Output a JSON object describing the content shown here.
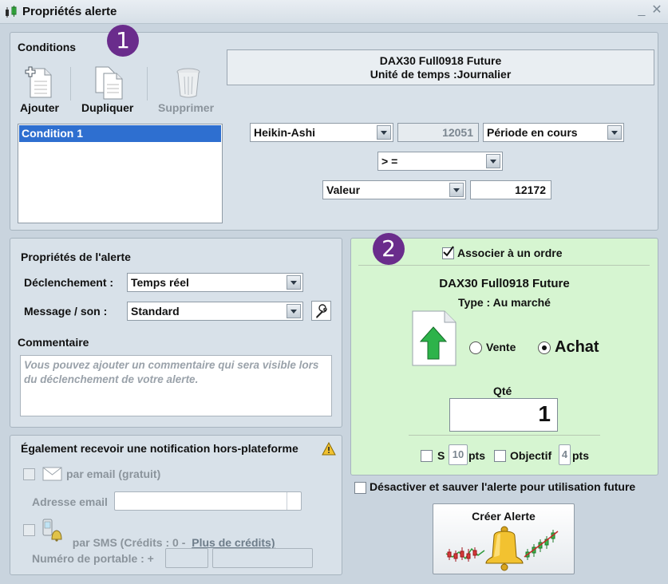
{
  "window": {
    "title": "Propriétés alerte"
  },
  "conditions": {
    "heading": "Conditions",
    "toolbar": {
      "add_label": "Ajouter",
      "duplicate_label": "Dupliquer",
      "delete_label": "Supprimer"
    },
    "list": [
      "Condition 1"
    ],
    "instrument_name": "DAX30 Full0918 Future",
    "timeframe": "Unité de temps :Journalier",
    "row1": {
      "indicator": "Heikin-Ashi",
      "value": "12051",
      "period": "Période en cours"
    },
    "operator": "> =",
    "row3": {
      "type": "Valeur",
      "value": "12172"
    }
  },
  "badges": {
    "one": "1",
    "two": "2"
  },
  "alert_props": {
    "heading": "Propriétés de l'alerte",
    "trigger_label": "Déclenchement :",
    "trigger_value": "Temps réel",
    "message_label": "Message / son :",
    "message_value": "Standard",
    "comment_label": "Commentaire",
    "comment_placeholder": "Vous pouvez ajouter un commentaire qui sera visible lors du déclenchement de votre alerte."
  },
  "notify": {
    "heading": "Également recevoir une notification hors-plateforme",
    "email_label": "par email (gratuit)",
    "email_address_label": "Adresse email",
    "sms_label": "par SMS (Crédits : 0 - ",
    "sms_link": "Plus de crédits)",
    "phone_label": "Numéro de portable : +"
  },
  "order": {
    "associate_label": "Associer à un ordre",
    "associate_checked": true,
    "instrument": "DAX30 Full0918 Future",
    "type_label": "Type : Au marché",
    "sell_label": "Vente",
    "buy_label": "Achat",
    "selected": "Achat",
    "qty_label": "Qté",
    "qty_value": "1",
    "stop_label": "S",
    "stop_value": "10",
    "stop_unit": "pts",
    "target_label": "Objectif",
    "target_value": "4",
    "target_unit": "pts"
  },
  "deactivate_label": "Désactiver et sauver l'alerte pour utilisation future",
  "create_button": "Créer Alerte",
  "colors": {
    "accent_purple": "#6a2c8c",
    "order_bg": "#d6f5d1",
    "link": "#6e7d8a"
  }
}
